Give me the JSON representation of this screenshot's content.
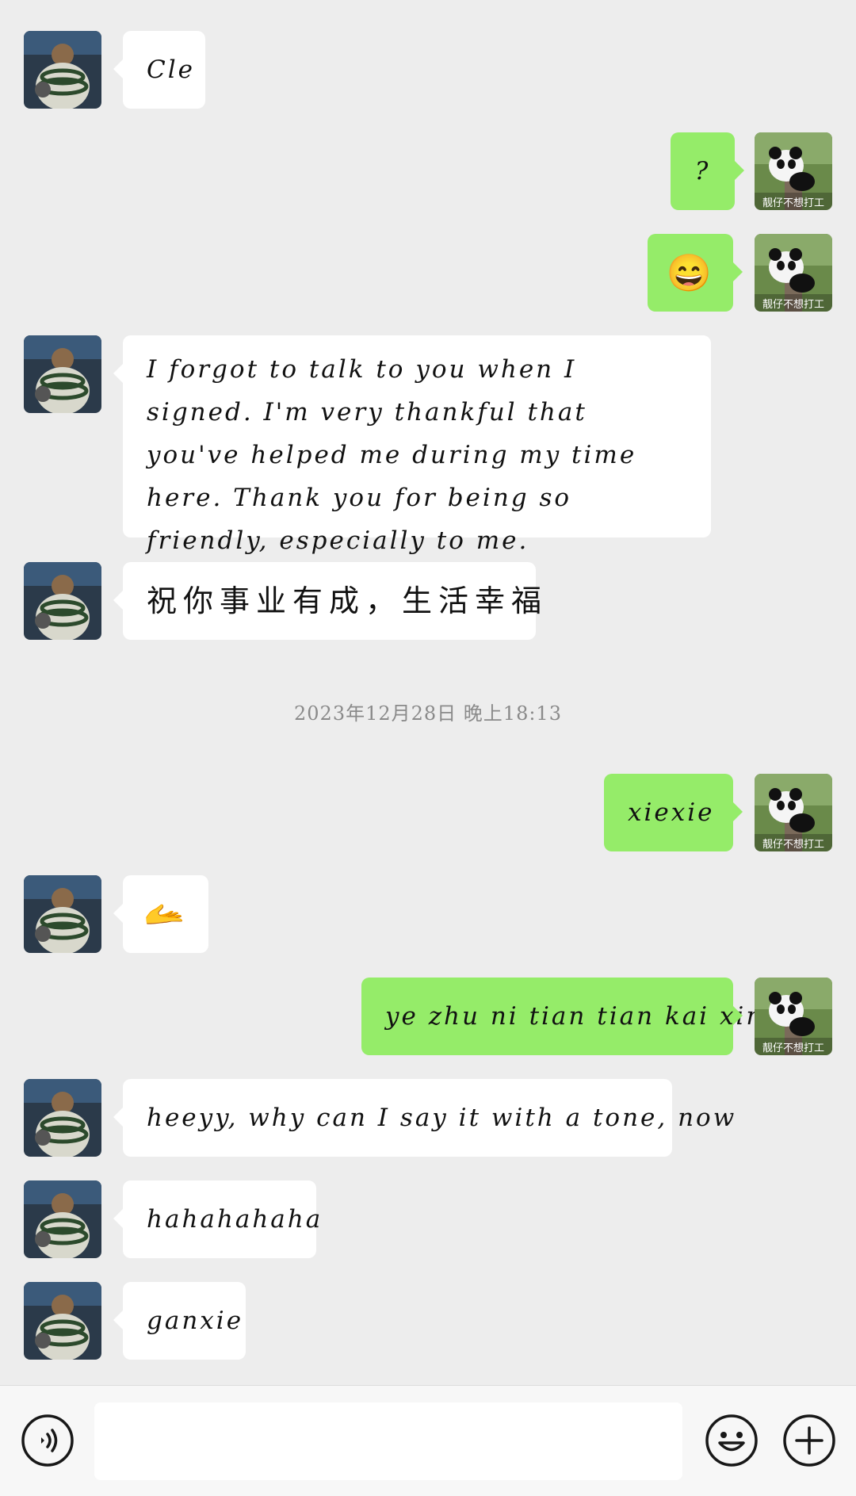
{
  "messages": [
    {
      "side": "left",
      "text": "Cle"
    },
    {
      "side": "right",
      "text": "?"
    },
    {
      "side": "right",
      "text": "😄"
    },
    {
      "side": "left",
      "text": "I forgot to talk to you when I signed. I'm very thankful that you've helped me during my time here. Thank you for being so friendly, especially to me."
    },
    {
      "side": "left",
      "text": "祝你事业有成，生活幸福"
    },
    {
      "side": "right",
      "text": "xiexie"
    },
    {
      "side": "left",
      "text": "🫴"
    },
    {
      "side": "right",
      "text": "ye zhu ni tian tian kai xin"
    },
    {
      "side": "left",
      "text": "heeyy, why can I say it with a tone, now"
    },
    {
      "side": "left",
      "text": "hahahahaha"
    },
    {
      "side": "left",
      "text": "ganxie"
    }
  ],
  "timestamp": "2023年12月28日 晚上18:13",
  "own_avatar_caption": "靓仔不想打工",
  "colors": {
    "background": "#ededed",
    "own_bubble": "#95ec69",
    "other_bubble": "#ffffff"
  },
  "bottom_bar": {
    "icons": [
      "voice-icon",
      "emoji-icon",
      "plus-icon"
    ]
  }
}
